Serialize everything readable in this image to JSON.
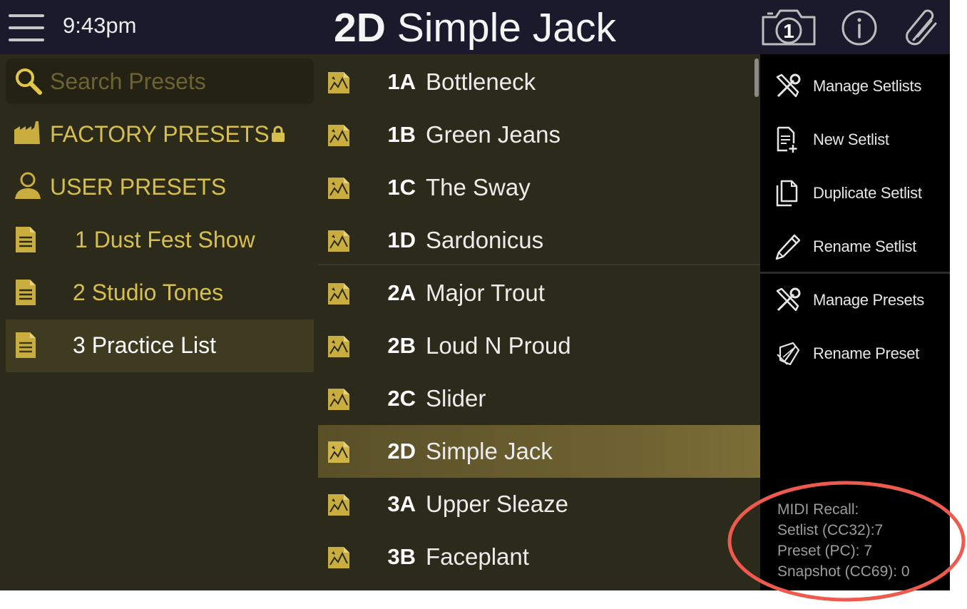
{
  "header": {
    "time": "9:43pm",
    "current_preset_code": "2D",
    "current_preset_name": "Simple Jack",
    "snapshot_number": "1"
  },
  "search": {
    "placeholder": "Search Presets"
  },
  "library": {
    "factory_label": "FACTORY PRESETS",
    "user_label": "USER PRESETS",
    "setlists": [
      {
        "number": "1",
        "name": "Dust Fest Show",
        "selected": false
      },
      {
        "number": "2",
        "name": "Studio Tones",
        "selected": false
      },
      {
        "number": "3",
        "name": "Practice List",
        "selected": true
      }
    ]
  },
  "presets": [
    {
      "code": "1A",
      "name": "Bottleneck"
    },
    {
      "code": "1B",
      "name": "Green Jeans"
    },
    {
      "code": "1C",
      "name": "The Sway"
    },
    {
      "code": "1D",
      "name": "Sardonicus"
    },
    {
      "code": "2A",
      "name": "Major Trout"
    },
    {
      "code": "2B",
      "name": "Loud N Proud"
    },
    {
      "code": "2C",
      "name": "Slider"
    },
    {
      "code": "2D",
      "name": "Simple Jack",
      "selected": true
    },
    {
      "code": "3A",
      "name": "Upper Sleaze"
    },
    {
      "code": "3B",
      "name": "Faceplant"
    }
  ],
  "menu": {
    "manage_setlists": "Manage Setlists",
    "new_setlist": "New Setlist",
    "duplicate_setlist": "Duplicate Setlist",
    "rename_setlist": "Rename Setlist",
    "manage_presets": "Manage Presets",
    "rename_preset": "Rename Preset"
  },
  "midi": {
    "title": "MIDI Recall:",
    "setlist": "Setlist (CC32):7",
    "preset": "Preset (PC): 7",
    "snapshot": "Snapshot (CC69): 0"
  },
  "colors": {
    "header_bg": "#1b1a2c",
    "panel_bg": "#2c2a1b",
    "accent_gold": "#d6bf4c",
    "selection": "#6e6232",
    "annotation_ring": "#ee5a4e"
  },
  "icons": {
    "menu": "hamburger-icon",
    "snapshot": "camera-icon",
    "info": "info-icon",
    "attach": "paperclip-icon",
    "search": "search-icon",
    "factory": "factory-icon",
    "user": "user-icon",
    "setlist": "document-icon",
    "preset": "preset-icon",
    "tools": "tools-icon",
    "new": "new-document-icon",
    "duplicate": "duplicate-icon",
    "rename": "pencil-icon",
    "rename_preset": "rename-preset-icon"
  }
}
